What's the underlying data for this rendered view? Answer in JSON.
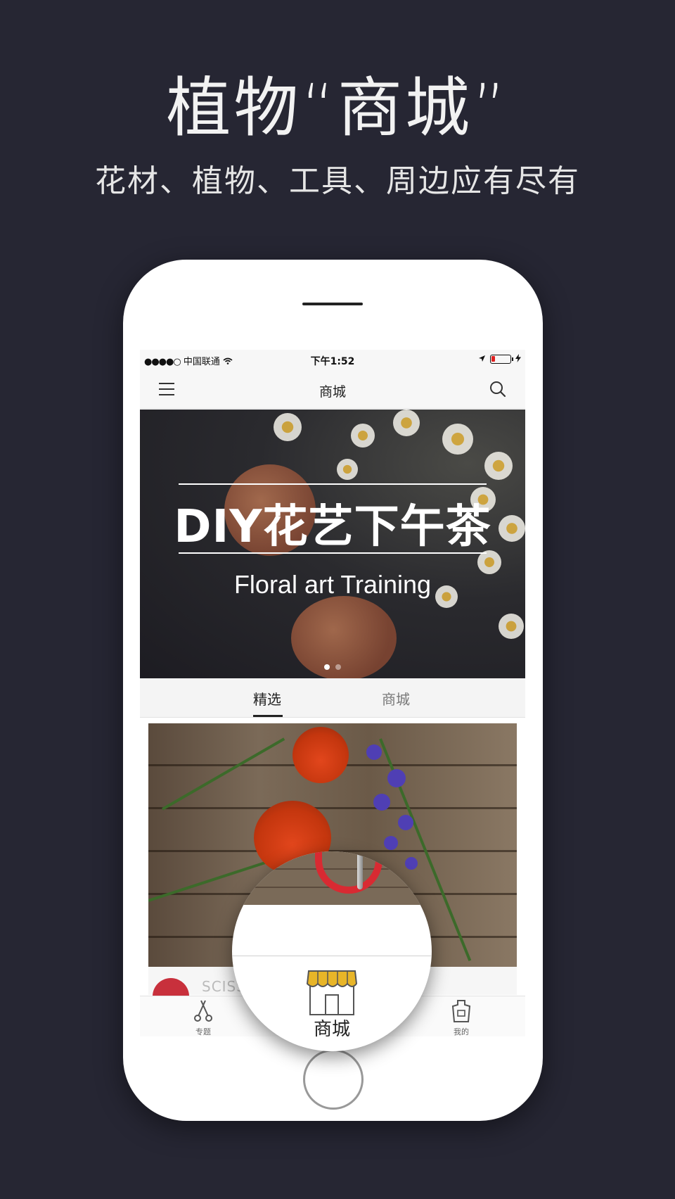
{
  "promo": {
    "headline": "植物“商城”",
    "subheadline": "花材、植物、工具、周边应有尽有"
  },
  "statusbar": {
    "signal": "●●●●○",
    "carrier": "中国联通",
    "time": "下午1:52",
    "battery_level": 0.2,
    "battery_color": "#e02020"
  },
  "navbar": {
    "title": "商城",
    "menu_icon": "menu-icon",
    "search_icon": "search-icon"
  },
  "banner": {
    "title": "DIY花艺下午茶",
    "subtitle": "Floral art Training",
    "slides": 2,
    "active_slide": 1
  },
  "tabs": [
    {
      "label": "精选",
      "active": true
    },
    {
      "label": "商城",
      "active": false
    }
  ],
  "product": {
    "brand_partial": "SCISS"
  },
  "tabbar": {
    "items": [
      {
        "label": "专题",
        "icon": "scissors-icon"
      },
      {
        "label": "商城",
        "icon": "shop-icon",
        "active": true
      },
      {
        "label": "我的",
        "icon": "apron-icon"
      }
    ]
  },
  "magnifier": {
    "label": "商城",
    "icon": "shop-awning-icon",
    "accent_color": "#e8b528"
  }
}
